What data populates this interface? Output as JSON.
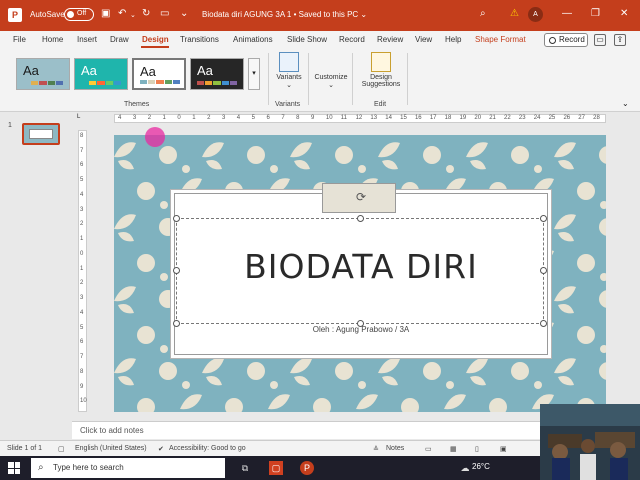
{
  "titlebar": {
    "autosave_label": "AutoSave",
    "toggle_state": "Off",
    "doc_title": "Biodata diri AGUNG 3A 1 • Saved to this PC ⌄",
    "avatar_initial": "A"
  },
  "menu": {
    "tabs": [
      "File",
      "Home",
      "Insert",
      "Draw",
      "Design",
      "Transitions",
      "Animations",
      "Slide Show",
      "Record",
      "Review",
      "View",
      "Help",
      "Shape Format"
    ],
    "active_tab": "Design",
    "record_button": "Record"
  },
  "ribbon": {
    "themes": [
      {
        "label": "Aa",
        "bg": "#9bbfc9",
        "fg": "#1a1a1a",
        "bars": [
          "#9bbfc9",
          "#e0b050",
          "#c05050",
          "#508050",
          "#5070b0"
        ]
      },
      {
        "label": "Aa",
        "bg": "#1fb5ac",
        "fg": "#ffffff",
        "bars": [
          "#1fb5ac",
          "#ffcc33",
          "#ff6633",
          "#66cc66",
          "#3399cc"
        ]
      },
      {
        "label": "Aa",
        "bg": "#ffffff",
        "fg": "#1a1a1a",
        "bars": [
          "#7fb2bf",
          "#d9d2b8",
          "#f08050",
          "#60a060",
          "#5080c0"
        ]
      },
      {
        "label": "Aa",
        "bg": "#262626",
        "fg": "#ffffff",
        "bars": [
          "#c0504d",
          "#f0a030",
          "#90c040",
          "#4090d0",
          "#8064a2"
        ]
      }
    ],
    "themes_group": "Themes",
    "variants_button": "Variants",
    "variants_group": "Variants",
    "customize_button": "Customize",
    "design_suggestions_button": "Design Suggestions",
    "edit_group": "Edit"
  },
  "ruler": {
    "h_labels": [
      "4",
      "3",
      "2",
      "1",
      "0",
      "1",
      "2",
      "3",
      "4",
      "5",
      "6",
      "7",
      "8",
      "9",
      "10",
      "11",
      "12",
      "13",
      "14",
      "15",
      "16",
      "17",
      "18",
      "19",
      "20",
      "21",
      "22",
      "23",
      "24",
      "25",
      "26",
      "27",
      "28"
    ],
    "v_labels": [
      "8",
      "7",
      "6",
      "5",
      "4",
      "3",
      "2",
      "1",
      "0",
      "1",
      "2",
      "3",
      "4",
      "5",
      "6",
      "7",
      "8",
      "9",
      "10"
    ]
  },
  "thumbnails": {
    "slide_number": "1",
    "thumb_title": "BIODATA DIRI"
  },
  "slide": {
    "title": "BIODATA DIRI",
    "subtitle": "Oleh : Agung Prabowo / 3A"
  },
  "notes": {
    "placeholder": "Click to add notes"
  },
  "statusbar": {
    "slide_info": "Slide 1 of 1",
    "language": "English (United States)",
    "accessibility": "Accessibility: Good to go",
    "notes_button": "Notes"
  },
  "taskbar": {
    "search_placeholder": "Type here to search",
    "temperature": "26°C"
  },
  "colors": {
    "accent": "#c43e1c",
    "slide_bg": "#7fb2bf",
    "pattern": "#e8e3d3"
  }
}
